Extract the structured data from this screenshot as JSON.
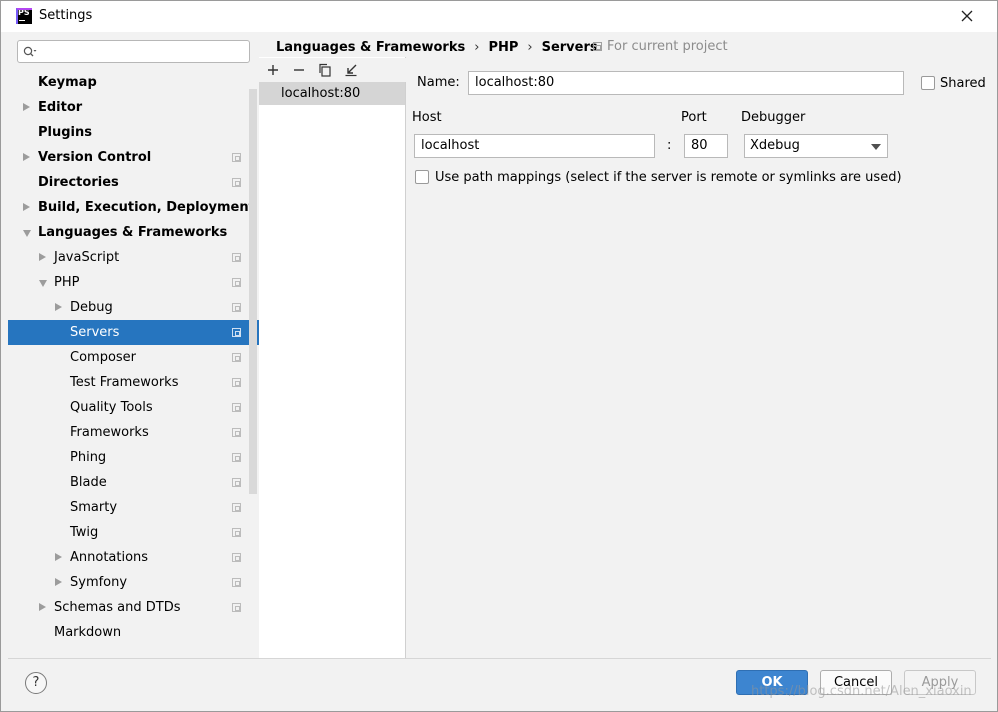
{
  "window": {
    "title": "Settings"
  },
  "search": {
    "placeholder": ""
  },
  "tree": [
    {
      "label": "Keymap",
      "bold": true,
      "arrow": "none",
      "indent": 0,
      "project": false,
      "selected": false
    },
    {
      "label": "Editor",
      "bold": true,
      "arrow": "right",
      "indent": 0,
      "project": false,
      "selected": false
    },
    {
      "label": "Plugins",
      "bold": true,
      "arrow": "none",
      "indent": 0,
      "project": false,
      "selected": false
    },
    {
      "label": "Version Control",
      "bold": true,
      "arrow": "right",
      "indent": 0,
      "project": true,
      "selected": false
    },
    {
      "label": "Directories",
      "bold": true,
      "arrow": "none",
      "indent": 0,
      "project": true,
      "selected": false
    },
    {
      "label": "Build, Execution, Deployment",
      "bold": true,
      "arrow": "right",
      "indent": 0,
      "project": false,
      "selected": false
    },
    {
      "label": "Languages & Frameworks",
      "bold": true,
      "arrow": "down",
      "indent": 0,
      "project": false,
      "selected": false
    },
    {
      "label": "JavaScript",
      "bold": false,
      "arrow": "right",
      "indent": 1,
      "project": true,
      "selected": false
    },
    {
      "label": "PHP",
      "bold": false,
      "arrow": "down",
      "indent": 1,
      "project": true,
      "selected": false
    },
    {
      "label": "Debug",
      "bold": false,
      "arrow": "right",
      "indent": 2,
      "project": true,
      "selected": false
    },
    {
      "label": "Servers",
      "bold": false,
      "arrow": "none",
      "indent": 2,
      "project": true,
      "selected": true
    },
    {
      "label": "Composer",
      "bold": false,
      "arrow": "none",
      "indent": 2,
      "project": true,
      "selected": false
    },
    {
      "label": "Test Frameworks",
      "bold": false,
      "arrow": "none",
      "indent": 2,
      "project": true,
      "selected": false
    },
    {
      "label": "Quality Tools",
      "bold": false,
      "arrow": "none",
      "indent": 2,
      "project": true,
      "selected": false
    },
    {
      "label": "Frameworks",
      "bold": false,
      "arrow": "none",
      "indent": 2,
      "project": true,
      "selected": false
    },
    {
      "label": "Phing",
      "bold": false,
      "arrow": "none",
      "indent": 2,
      "project": true,
      "selected": false
    },
    {
      "label": "Blade",
      "bold": false,
      "arrow": "none",
      "indent": 2,
      "project": true,
      "selected": false
    },
    {
      "label": "Smarty",
      "bold": false,
      "arrow": "none",
      "indent": 2,
      "project": true,
      "selected": false
    },
    {
      "label": "Twig",
      "bold": false,
      "arrow": "none",
      "indent": 2,
      "project": true,
      "selected": false
    },
    {
      "label": "Annotations",
      "bold": false,
      "arrow": "right",
      "indent": 2,
      "project": true,
      "selected": false
    },
    {
      "label": "Symfony",
      "bold": false,
      "arrow": "right",
      "indent": 2,
      "project": true,
      "selected": false
    },
    {
      "label": "Schemas and DTDs",
      "bold": false,
      "arrow": "right",
      "indent": 1,
      "project": true,
      "selected": false
    },
    {
      "label": "Markdown",
      "bold": false,
      "arrow": "none",
      "indent": 1,
      "project": false,
      "selected": false
    }
  ],
  "breadcrumb": {
    "part1": "Languages & Frameworks",
    "part2": "PHP",
    "part3": "Servers",
    "separator": "›"
  },
  "scope": {
    "label": "For current project"
  },
  "servers": {
    "items": [
      "localhost:80"
    ]
  },
  "form": {
    "name_label": "Name:",
    "name_value": "localhost:80",
    "shared_label": "Shared",
    "host_label": "Host",
    "host_value": "localhost",
    "colon": ":",
    "port_label": "Port",
    "port_value": "80",
    "debugger_label": "Debugger",
    "debugger_value": "Xdebug",
    "path_mappings_label": "Use path mappings (select if the server is remote or symlinks are used)"
  },
  "buttons": {
    "help": "?",
    "ok": "OK",
    "cancel": "Cancel",
    "apply": "Apply"
  },
  "watermark": "https://blog.csdn.net/Alen_xiaoxin",
  "colors": {
    "selection": "#2675bf",
    "primary_button": "#3d85d0",
    "panel_bg": "#f2f2f2"
  }
}
